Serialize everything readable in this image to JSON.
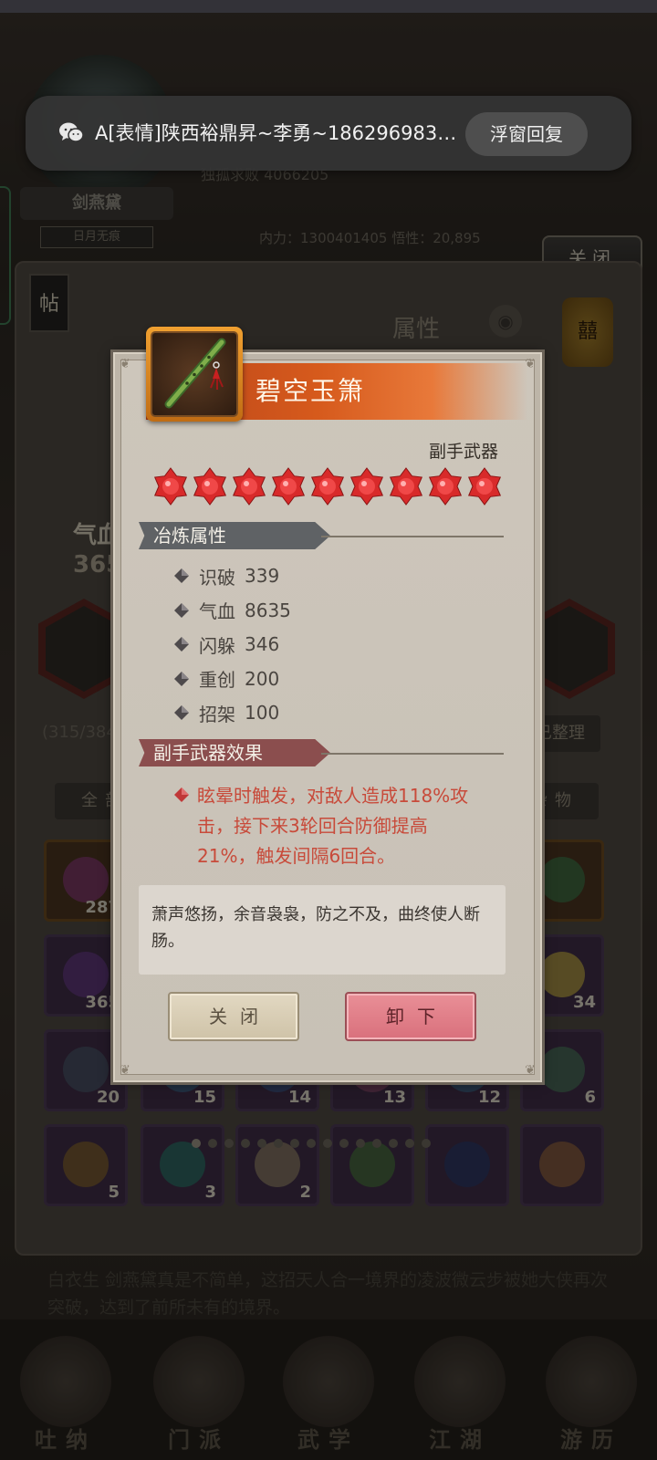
{
  "notification": {
    "app_icon": "wechat-icon",
    "message": "A[表情]陕西裕鼎昇~李勇~186296983…",
    "action_label": "浮窗回复"
  },
  "background": {
    "name_plate": "剑燕黛",
    "name_sub": "日月无痕",
    "stat_line_1": "独孤求败    4066205",
    "stat_line_2": "内力：1300401405   悟性：20,895",
    "close_label": "关闭",
    "tie_label": "帖",
    "attr_title": "属性",
    "qixue_label": "气血",
    "qixue_value": "365",
    "bag_count": "(315/384)",
    "sorted_label": "已整理",
    "tab_all": "全部",
    "tab_misc": "杂物",
    "slots": [
      {
        "count": "287",
        "style": "orange",
        "color": "#8a3a7a"
      },
      {
        "count": "",
        "style": "",
        "color": "#555"
      },
      {
        "count": "",
        "style": "",
        "color": "#555"
      },
      {
        "count": "",
        "style": "",
        "color": "#555"
      },
      {
        "count": "",
        "style": "",
        "color": "#555"
      },
      {
        "count": "",
        "style": "orange",
        "color": "#3a7a4a"
      },
      {
        "count": "365",
        "style": "",
        "color": "#6a3a8a"
      },
      {
        "count": "",
        "style": "",
        "color": "#555"
      },
      {
        "count": "",
        "style": "",
        "color": "#555"
      },
      {
        "count": "",
        "style": "",
        "color": "#555"
      },
      {
        "count": "",
        "style": "",
        "color": "#555"
      },
      {
        "count": "34",
        "style": "",
        "color": "#c8b040"
      },
      {
        "count": "20",
        "style": "",
        "color": "#4a5a6a"
      },
      {
        "count": "15",
        "style": "",
        "color": "#3a6a8a"
      },
      {
        "count": "14",
        "style": "",
        "color": "#3a5a8a"
      },
      {
        "count": "13",
        "style": "",
        "color": "#8a4a6a"
      },
      {
        "count": "12",
        "style": "",
        "color": "#3a6a8a"
      },
      {
        "count": "6",
        "style": "",
        "color": "#4a7a5a"
      },
      {
        "count": "5",
        "style": "",
        "color": "#8a6a2a"
      },
      {
        "count": "3",
        "style": "",
        "color": "#2a7a6a"
      },
      {
        "count": "2",
        "style": "",
        "color": "#9a8a6a"
      },
      {
        "count": "",
        "style": "",
        "color": "#4a7a3a"
      },
      {
        "count": "",
        "style": "",
        "color": "#2a3a6a"
      },
      {
        "count": "",
        "style": "",
        "color": "#9a6a3a"
      }
    ],
    "story_text": "白衣生 剑燕黛真是不简单，这招天人合一境界的凌波微云步被她大侠再次突破，达到了前所未有的境界。",
    "nav": [
      {
        "label": "吐纳",
        "icon": "tuna-icon"
      },
      {
        "label": "门派",
        "icon": "sect-icon"
      },
      {
        "label": "武学",
        "icon": "martial-icon"
      },
      {
        "label": "江湖",
        "icon": "jianghu-icon"
      },
      {
        "label": "游历",
        "icon": "travel-icon"
      }
    ]
  },
  "item": {
    "name": "碧空玉箫",
    "icon": "jade-flute-icon",
    "type": "副手武器",
    "star_count": 9,
    "star_color": "#d82a2a",
    "refine_title": "冶炼属性",
    "attributes": [
      {
        "name": "识破",
        "value": "339"
      },
      {
        "name": "气血",
        "value": "8635"
      },
      {
        "name": "闪躲",
        "value": "346"
      },
      {
        "name": "重创",
        "value": "200"
      },
      {
        "name": "招架",
        "value": "100"
      }
    ],
    "effect_title": "副手武器效果",
    "effect_text": "眩晕时触发，对敌人造成118%攻击，接下来3轮回合防御提高21%，触发间隔6回合。",
    "description": "萧声悠扬，余音袅袅，防之不及，曲终使人断肠。"
  },
  "buttons": {
    "close_label": "关闭",
    "unequip_label": "卸下"
  },
  "colors": {
    "title_gradient_start": "#b8441a",
    "effect_text": "#c84a3a",
    "unequip_button": "#d9707c"
  }
}
